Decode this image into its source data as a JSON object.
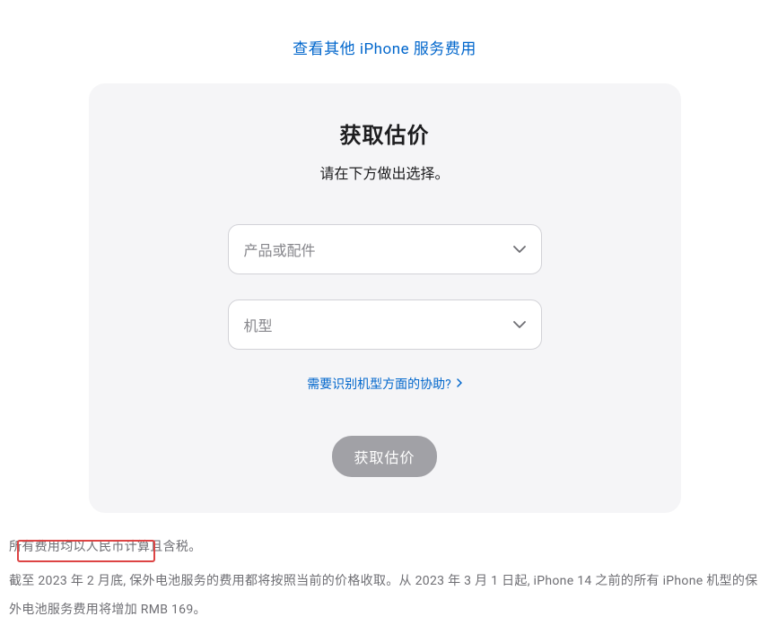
{
  "topLink": "查看其他 iPhone 服务费用",
  "card": {
    "title": "获取估价",
    "subtitle": "请在下方做出选择。",
    "select1Placeholder": "产品或配件",
    "select2Placeholder": "机型",
    "helpLink": "需要识别机型方面的协助?",
    "submitLabel": "获取估价"
  },
  "footer": {
    "line1": "所有费用均以人民币计算且含税。",
    "line2": "截至 2023 年 2 月底, 保外电池服务的费用都将按照当前的价格收取。从 2023 年 3 月 1 日起, iPhone 14 之前的所有 iPhone 机型的保外电池服务费用将增加 RMB 169。"
  }
}
